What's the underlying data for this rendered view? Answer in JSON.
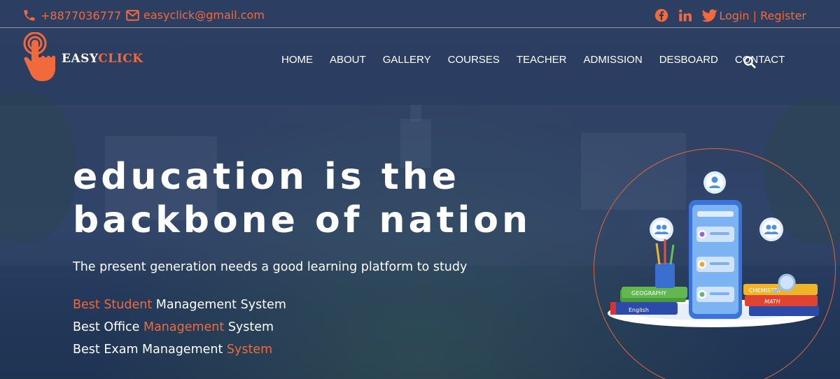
{
  "topbar": {
    "phone": "+8877036777",
    "email": "easyclick@gmail.com",
    "social": [
      "facebook-icon",
      "linkedin-icon",
      "twitter-icon"
    ],
    "login": "Login",
    "separator": "|",
    "register": "Register"
  },
  "brand": {
    "part1": "EASY",
    "part2": "CLICK"
  },
  "nav": [
    "HOME",
    "ABOUT",
    "GALLERY",
    "COURSES",
    "TEACHER",
    "ADMISSION",
    "DESBOARD",
    "CONTACT"
  ],
  "hero": {
    "headline_line1": "education is the",
    "headline_line2": "backbone of nation",
    "subtext": "The present generation needs a good learning platform to study",
    "features": [
      {
        "pre": "",
        "accent": "Best Student",
        "post": " Management System"
      },
      {
        "pre": "Best Office ",
        "accent": "Management",
        "post": " System"
      },
      {
        "pre": "Best Exam Management ",
        "accent": "System",
        "post": ""
      }
    ]
  },
  "illustration": {
    "book_labels": [
      "GEOGRAPHY",
      "English",
      "CHEMISTRY",
      "MATH"
    ]
  },
  "colors": {
    "accent": "#f06a3c",
    "background": "#23365a",
    "text": "#ffffff"
  }
}
